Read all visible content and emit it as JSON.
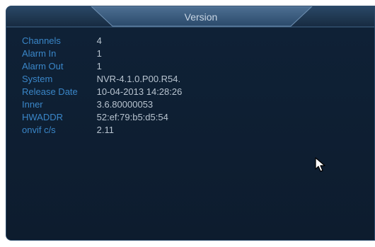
{
  "window": {
    "title": "Version"
  },
  "info": {
    "rows": [
      {
        "label": "Channels",
        "value": "4"
      },
      {
        "label": "Alarm In",
        "value": "1"
      },
      {
        "label": "Alarm Out",
        "value": "1"
      },
      {
        "label": "System",
        "value": "NVR-4.1.0.P00.R54."
      },
      {
        "label": "Release Date",
        "value": "10-04-2013 14:28:26"
      },
      {
        "label": "Inner",
        "value": "3.6.80000053"
      },
      {
        "label": "HWADDR",
        "value": "52:ef:79:b5:d5:54"
      },
      {
        "label": "onvif c/s",
        "value": "2.11"
      }
    ]
  },
  "colors": {
    "label": "#3a86c8",
    "value": "#b8c4d0",
    "background": "#0e1e30",
    "title": "#c9d6e4"
  },
  "icons": {
    "cursor": "mouse-pointer-icon"
  }
}
